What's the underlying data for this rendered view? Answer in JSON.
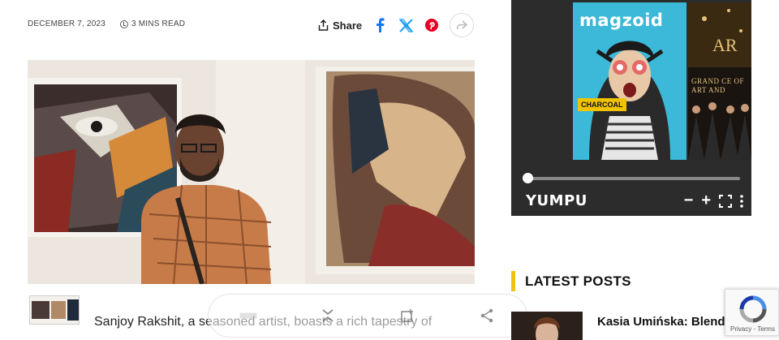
{
  "article": {
    "date": "DECEMBER 7, 2023",
    "read_time": "3 MINS READ",
    "share_label": "Share",
    "social_icons": [
      "facebook-icon",
      "x-icon",
      "pinterest-icon",
      "forward-icon"
    ],
    "body_start": "Sanjoy Rakshit, a seasoned artist, boasts a rich tapestry of"
  },
  "toolbar": {
    "icons": [
      "image-thumb-icon",
      "collapse-icon",
      "add-to-queue-icon",
      "share-icon"
    ]
  },
  "magazine": {
    "cover_title": "magzoid",
    "cover_badge": "CHARCOAL",
    "second_cover_text": "GRAND CE OF ART AND",
    "second_cover_top": "AR",
    "brand": "YUMPU",
    "progress": 0.0,
    "controls": [
      "−",
      "+",
      "⛶",
      "⋮"
    ]
  },
  "sidebar": {
    "latest_heading": "LATEST POSTS",
    "post_title": "Kasia Umińska: Blending Reality and Fantasy"
  },
  "recaptcha": {
    "label": "Privacy - Terms"
  },
  "colors": {
    "accent": "#f2c010",
    "facebook": "#1877f2",
    "x": "#1da1f2",
    "pinterest": "#e60023",
    "widget_bg": "#2c2c2c"
  }
}
